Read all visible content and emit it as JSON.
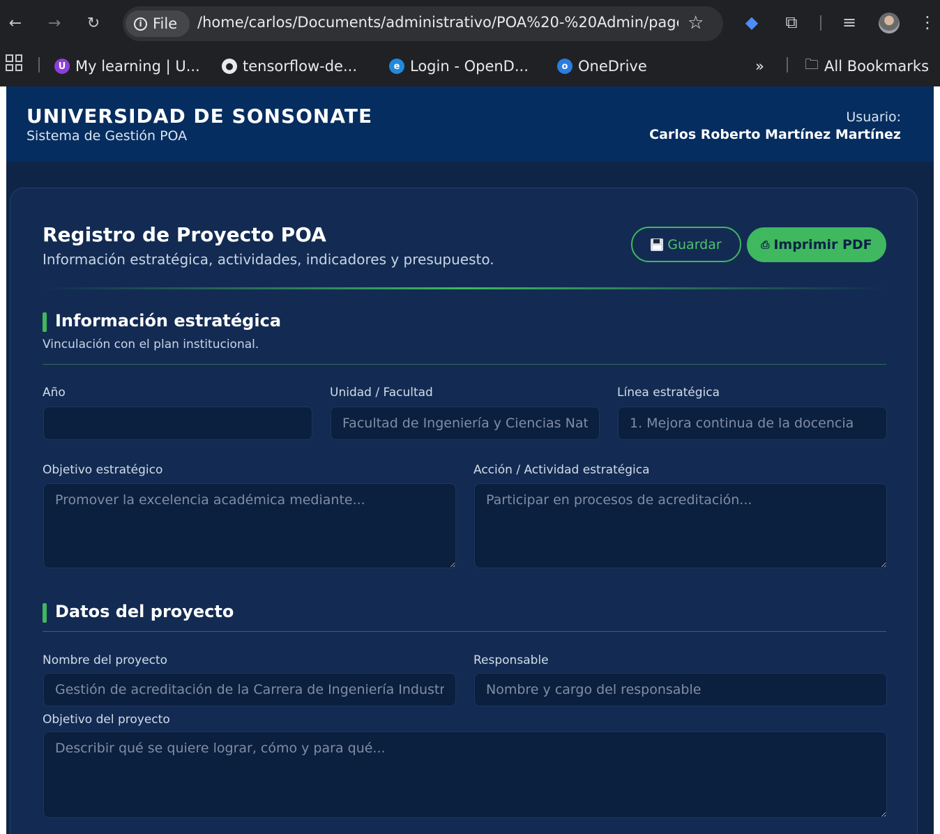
{
  "browser": {
    "chip_label": "File",
    "url": "/home/carlos/Documents/administrativo/POA%20-%20Admin/page...",
    "bookmarks": [
      {
        "label": "My learning | U..."
      },
      {
        "label": "tensorflow-de..."
      },
      {
        "label": "Login - OpenD..."
      },
      {
        "label": "OneDrive"
      }
    ],
    "overflow_label": "»",
    "all_bookmarks_label": "All Bookmarks"
  },
  "header": {
    "title": "UNIVERSIDAD DE SONSONATE",
    "subtitle": "Sistema de Gestión POA",
    "user_label": "Usuario:",
    "user_name": "Carlos Roberto Martínez Martínez"
  },
  "card": {
    "title": "Registro de Proyecto POA",
    "subtitle": "Información estratégica, actividades, indicadores y presupuesto.",
    "save_label": "Guardar",
    "print_label": "Imprimir PDF"
  },
  "strategic": {
    "title": "Información estratégica",
    "subtitle": "Vinculación con el plan institucional.",
    "year_label": "Año",
    "year_value": "",
    "unit_label": "Unidad / Facultad",
    "unit_placeholder": "Facultad de Ingeniería y Ciencias Naturales",
    "line_label": "Línea estratégica",
    "line_placeholder": "1. Mejora continua de la docencia",
    "objective_label": "Objetivo estratégico",
    "objective_placeholder": "Promover la excelencia académica mediante...",
    "action_label": "Acción / Actividad estratégica",
    "action_placeholder": "Participar en procesos de acreditación..."
  },
  "project": {
    "title": "Datos del proyecto",
    "name_label": "Nombre del proyecto",
    "name_placeholder": "Gestión de acreditación de la Carrera de Ingeniería Industrial",
    "responsible_label": "Responsable",
    "responsible_placeholder": "Nombre y cargo del responsable",
    "objective_label": "Objetivo del proyecto",
    "objective_placeholder": "Describir qué se quiere lograr, cómo y para qué..."
  },
  "colors": {
    "accent": "#3fb85f",
    "header_bg": "#062d5f",
    "page_bg": "#0f2547",
    "card_bg": "#132b52"
  }
}
